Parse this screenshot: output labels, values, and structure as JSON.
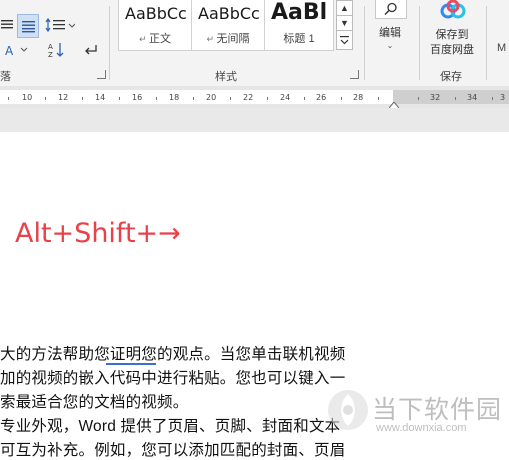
{
  "ribbon": {
    "paragraph_group_label": "落",
    "styles_group_label": "样式",
    "styles": [
      {
        "sample": "AaBbCc",
        "name": "正文"
      },
      {
        "sample": "AaBbCc",
        "name": "无间隔"
      },
      {
        "sample": "AaBl",
        "name": "标题 1"
      }
    ],
    "edit_label": "编辑",
    "save_label_line1": "保存到",
    "save_label_line2": "百度网盘",
    "save_group_label": "保存",
    "overflow_label": "M"
  },
  "ruler": {
    "ticks": [
      "10",
      "12",
      "14",
      "16",
      "18",
      "20",
      "22",
      "24",
      "26",
      "28",
      "32",
      "34",
      "3"
    ]
  },
  "document": {
    "shortcut": "Alt+Shift+→",
    "lines": [
      "大的方法帮助您证明您的观点。当您单击联机视频",
      "加的视频的嵌入代码中进行粘贴。您也可以键入一",
      "索最适合您的文档的视频。",
      "专业外观，Word 提供了页眉、页脚、封面和文本",
      "可互为补充。例如，您可以添加匹配的封面、页眉"
    ]
  },
  "watermark": {
    "name": "当下软件园",
    "url": "www.downxia.com"
  }
}
